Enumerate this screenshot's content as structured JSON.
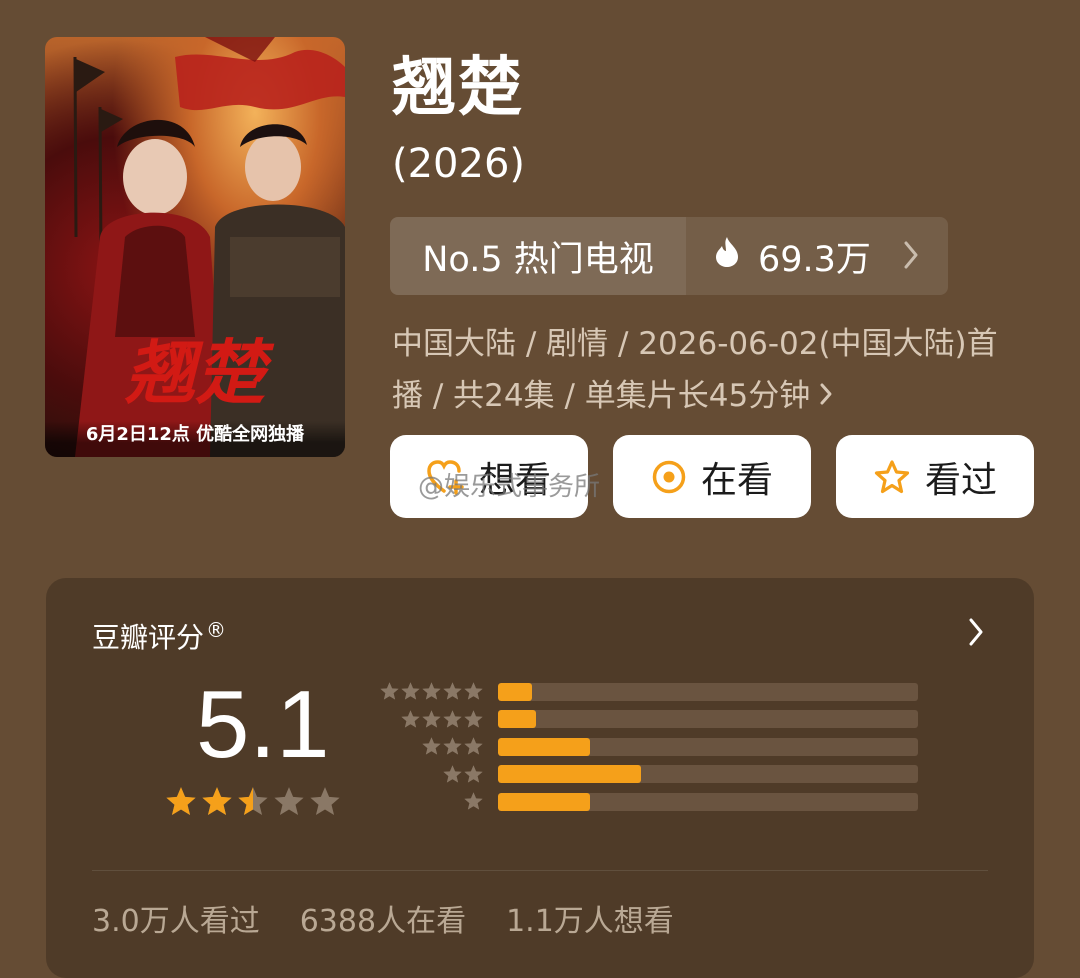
{
  "poster": {
    "caption": "6月2日12点 优酷全网独播",
    "calligraphy_title": "翘楚"
  },
  "title": "翘楚",
  "year": "(2026)",
  "rank": {
    "label": "No.5 热门电视",
    "heat": "69.3万",
    "flame_icon": "flame-icon"
  },
  "meta": {
    "line1": "中国大陆 / 剧情 / 2026-06-02(中国大陆)首",
    "line2": "播 / 共24集 / 单集片长45分钟"
  },
  "actions": {
    "want": "想看",
    "watching": "在看",
    "watched": "看过"
  },
  "watermark": "@娱乐式事务所",
  "rating": {
    "title": "豆瓣评分",
    "trademark": "®",
    "score": "5.1",
    "score_value": 5.1,
    "stars_filled": 2.5,
    "distribution": [
      {
        "stars": 5,
        "percent": 8
      },
      {
        "stars": 4,
        "percent": 9
      },
      {
        "stars": 3,
        "percent": 22
      },
      {
        "stars": 2,
        "percent": 34
      },
      {
        "stars": 1,
        "percent": 22
      }
    ],
    "stats": {
      "watched": "3.0万人看过",
      "watching": "6388人在看",
      "want": "1.1万人想看"
    }
  },
  "colors": {
    "background": "#654c34",
    "card": "#4f3b28",
    "accent": "#f5a01a",
    "star_empty": "#8a7866"
  }
}
